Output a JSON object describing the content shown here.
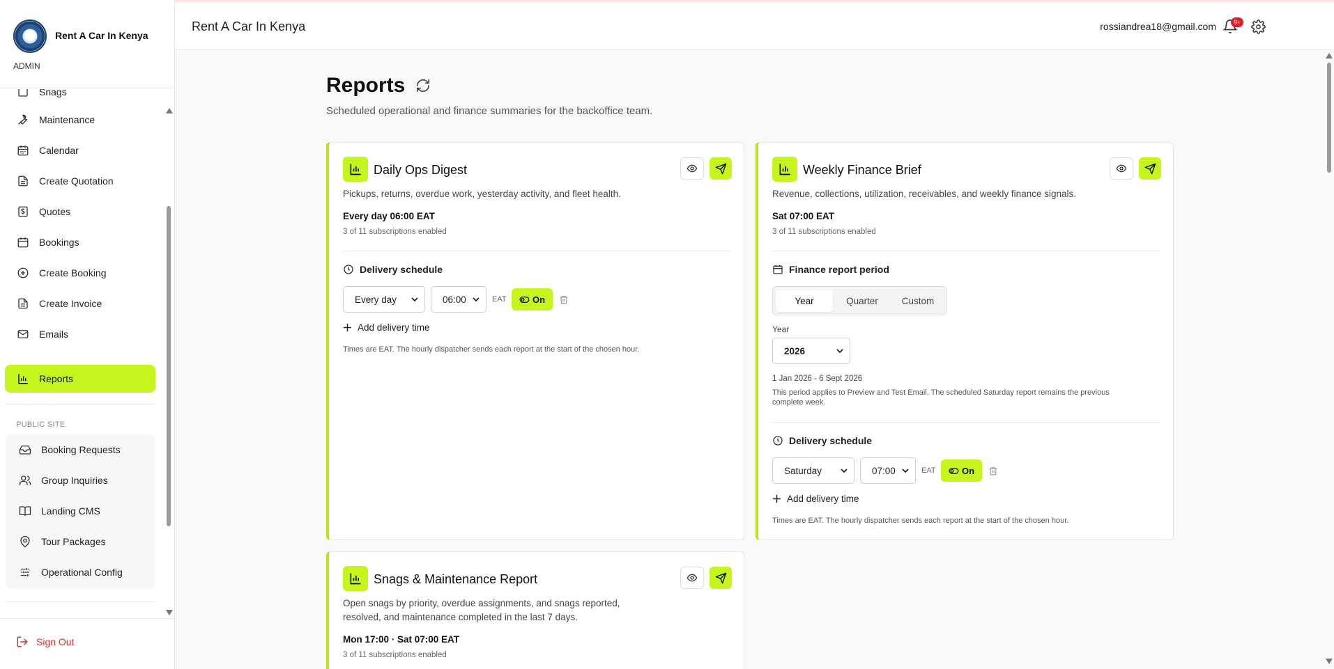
{
  "brand": {
    "name": "Rent A Car In Kenya",
    "role": "ADMIN"
  },
  "sidebar": {
    "items": [
      {
        "label": "Snags",
        "icon": "snag-icon"
      },
      {
        "label": "Maintenance",
        "icon": "wrench-icon"
      },
      {
        "label": "Calendar",
        "icon": "calendar-icon"
      },
      {
        "label": "Create Quotation",
        "icon": "document-icon"
      },
      {
        "label": "Quotes",
        "icon": "dollar-icon"
      },
      {
        "label": "Bookings",
        "icon": "calendar-icon"
      },
      {
        "label": "Create Booking",
        "icon": "plus-circle-icon"
      },
      {
        "label": "Create Invoice",
        "icon": "document-icon"
      },
      {
        "label": "Emails",
        "icon": "mail-icon"
      },
      {
        "label": "Reports",
        "icon": "bar-chart-icon",
        "active": true
      }
    ],
    "public_label": "PUBLIC SITE",
    "public_items": [
      {
        "label": "Booking Requests",
        "icon": "inbox-icon"
      },
      {
        "label": "Group Inquiries",
        "icon": "users-icon"
      },
      {
        "label": "Landing CMS",
        "icon": "book-icon"
      },
      {
        "label": "Tour Packages",
        "icon": "map-pin-icon"
      },
      {
        "label": "Operational Config",
        "icon": "sliders-icon"
      }
    ],
    "sign_out": "Sign Out"
  },
  "topbar": {
    "title": "Rent A Car In Kenya",
    "email": "rossiandrea18@gmail.com",
    "notif_badge": "9+"
  },
  "page": {
    "title": "Reports",
    "subtitle": "Scheduled operational and finance summaries for the backoffice team."
  },
  "cards": {
    "daily": {
      "title": "Daily Ops Digest",
      "description": "Pickups, returns, overdue work, yesterday activity, and fleet health.",
      "schedule": "Every day 06:00 EAT",
      "subscriptions": "3 of 11 subscriptions enabled",
      "delivery_heading": "Delivery schedule",
      "frequency": "Every day",
      "time": "06:00",
      "tz": "EAT",
      "toggle": "On",
      "add_time": "Add delivery time",
      "note": "Times are EAT. The hourly dispatcher sends each report at the start of the chosen hour."
    },
    "weekly": {
      "title": "Weekly Finance Brief",
      "description": "Revenue, collections, utilization, receivables, and weekly finance signals.",
      "schedule": "Sat 07:00 EAT",
      "subscriptions": "3 of 11 subscriptions enabled",
      "period_heading": "Finance report period",
      "period_options": [
        "Year",
        "Quarter",
        "Custom"
      ],
      "period_selected": "Year",
      "year_label": "Year",
      "year_value": "2026",
      "range": "1 Jan 2026 - 6 Sept 2026",
      "period_note_1": "This period applies to Preview and Test Email. The scheduled Saturday report remains the previous",
      "period_note_2": "complete week.",
      "delivery_heading": "Delivery schedule",
      "frequency": "Saturday",
      "time": "07:00",
      "tz": "EAT",
      "toggle": "On",
      "add_time": "Add delivery time",
      "note": "Times are EAT. The hourly dispatcher sends each report at the start of the chosen hour."
    },
    "snags": {
      "title": "Snags & Maintenance Report",
      "description_1": "Open snags by priority, overdue assignments, and snags reported,",
      "description_2": "resolved, and maintenance completed in the last 7 days.",
      "schedule": "Mon 17:00 · Sat 07:00 EAT",
      "subscriptions": "3 of 11 subscriptions enabled"
    }
  },
  "colors": {
    "accent": "#c6f51e",
    "danger": "#d32f2f"
  }
}
